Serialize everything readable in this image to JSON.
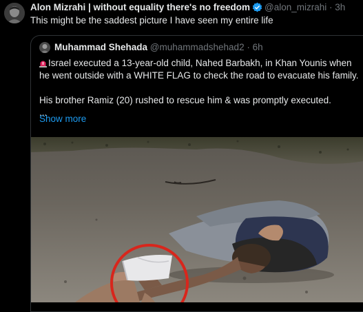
{
  "author": {
    "name": "Alon Mizrahi | without equality there's no freedom",
    "handle": "@alon_mizrahi",
    "time": "· 3h"
  },
  "tweet_text": "This might be the saddest picture I have seen my entire life",
  "quoted": {
    "name": "Muhammad Shehada",
    "handle": "@muhammadshehad2 · 6h",
    "lines": [
      "Israel executed a 13-year-old child, Nahed Barbakh, in Khan Younis when",
      "he went outside with a WHITE FLAG to check the road to evacuate his family.",
      "",
      "His brother Ramiz (20) rushed to rescue him & was promptly executed.",
      "..."
    ],
    "show_more": "Show more"
  },
  "colors": {
    "background": "#000000",
    "text": "#e7e9ea",
    "muted": "#71767b",
    "link": "#1d9bf0",
    "verified": "#1d9bf0",
    "circle": "#d8261c"
  },
  "icons": [
    "verified-badge-icon",
    "siren-icon"
  ]
}
